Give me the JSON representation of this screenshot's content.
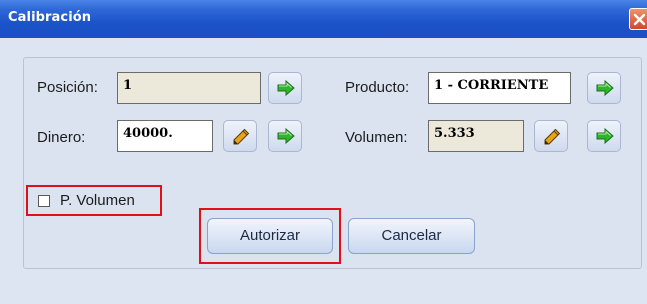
{
  "window": {
    "title": "Calibración"
  },
  "form": {
    "posicion": {
      "label": "Posición:",
      "value": "1"
    },
    "producto": {
      "label": "Producto:",
      "value": "1 - CORRIENTE"
    },
    "dinero": {
      "label": "Dinero:",
      "value": "40000."
    },
    "volumen": {
      "label": "Volumen:",
      "value": "5.333"
    },
    "p_volumen": {
      "label": "P. Volumen",
      "checked": false
    }
  },
  "buttons": {
    "autorizar": "Autorizar",
    "cancelar": "Cancelar"
  },
  "icons": {
    "go": "green-arrow-right-icon",
    "edit": "pencil-icon",
    "close": "close-icon"
  },
  "colors": {
    "titlebar": "#1d53c9",
    "panel": "#dbe3f1",
    "highlight": "#e0101a",
    "arrow": "#2db52d"
  }
}
